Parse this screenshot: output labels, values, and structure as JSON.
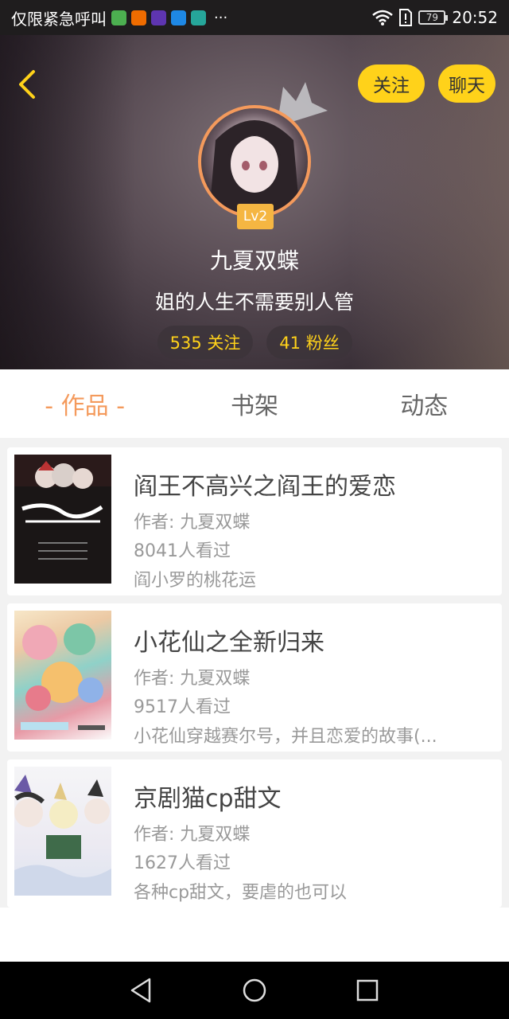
{
  "status_bar": {
    "carrier_text": "仅限紧急呼叫",
    "more": "···",
    "battery": "79",
    "time": "20:52",
    "app_icon_colors": [
      "#4caf50",
      "#ef6c00",
      "#5e35b1",
      "#1e88e5",
      "#26a69a"
    ]
  },
  "header": {
    "follow_label": "关注",
    "chat_label": "聊天",
    "level": "Lv2",
    "username": "九夏双蝶",
    "signature": "姐的人生不需要别人管",
    "following": "535 关注",
    "fans": "41 粉丝"
  },
  "tabs": [
    {
      "label": "- 作品 -",
      "active": true
    },
    {
      "label": "书架",
      "active": false
    },
    {
      "label": "动态",
      "active": false
    }
  ],
  "works": [
    {
      "title": "阎王不高兴之阎王的爱恋",
      "author": "作者: 九夏双蝶",
      "views": "8041人看过",
      "desc": "阎小罗的桃花运"
    },
    {
      "title": "小花仙之全新归来",
      "author": "作者: 九夏双蝶",
      "views": "9517人看过",
      "desc": "小花仙穿越赛尔号，并且恋爱的故事(..."
    },
    {
      "title": "京剧猫cp甜文",
      "author": "作者: 九夏双蝶",
      "views": "1627人看过",
      "desc": "各种cp甜文，要虐的也可以"
    }
  ],
  "colors": {
    "accent_yellow": "#ffd21a",
    "accent_orange": "#f49a5c"
  }
}
